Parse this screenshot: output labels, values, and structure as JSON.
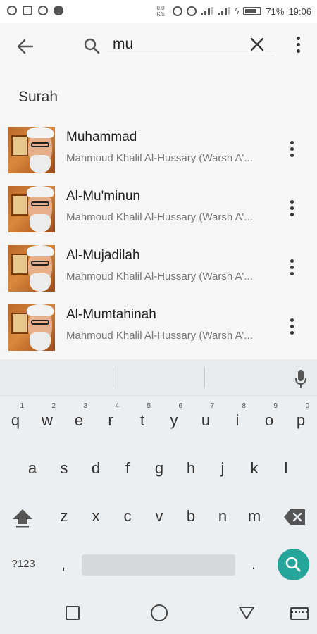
{
  "status_bar": {
    "net_speed": "0.0 K/s",
    "battery": "71%",
    "time": "19:06"
  },
  "search": {
    "query": "mu"
  },
  "section_title": "Surah",
  "results": [
    {
      "title": "Muhammad",
      "subtitle": "Mahmoud Khalil Al-Hussary (Warsh A'..."
    },
    {
      "title": "Al-Mu'minun",
      "subtitle": "Mahmoud Khalil Al-Hussary (Warsh A'..."
    },
    {
      "title": "Al-Mujadilah",
      "subtitle": "Mahmoud Khalil Al-Hussary (Warsh A'..."
    },
    {
      "title": "Al-Mumtahinah",
      "subtitle": "Mahmoud Khalil Al-Hussary (Warsh A'..."
    }
  ],
  "keyboard": {
    "row1": [
      "q",
      "w",
      "e",
      "r",
      "t",
      "y",
      "u",
      "i",
      "o",
      "p"
    ],
    "row1_hints": [
      "1",
      "2",
      "3",
      "4",
      "5",
      "6",
      "7",
      "8",
      "9",
      "0"
    ],
    "row2": [
      "a",
      "s",
      "d",
      "f",
      "g",
      "h",
      "j",
      "k",
      "l"
    ],
    "row3": [
      "z",
      "x",
      "c",
      "v",
      "b",
      "n",
      "m"
    ],
    "symbols_label": "?123",
    "comma": ",",
    "period": "."
  },
  "colors": {
    "accent": "#26a69a",
    "header_bg": "#f6f6f6",
    "keyboard_bg": "#eceff1"
  }
}
